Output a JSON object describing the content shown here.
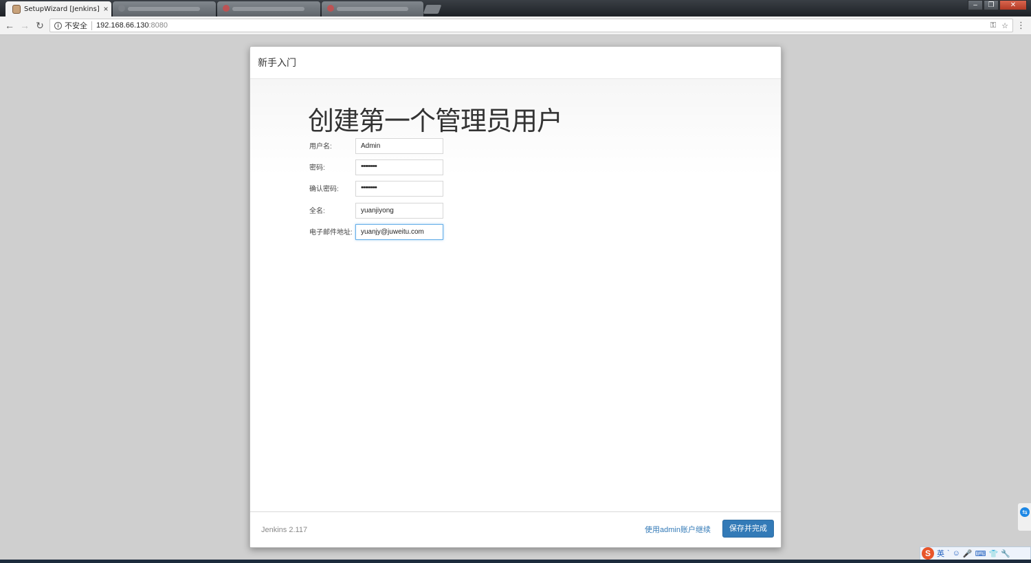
{
  "browser": {
    "active_tab_title": "SetupWizard [Jenkins]",
    "close_glyph": "×",
    "nav": {
      "back": "←",
      "forward": "→",
      "reload": "↻",
      "menu": "⋮"
    },
    "security_label": "不安全",
    "url_host": "192.168.66.130",
    "url_port": ":8080",
    "window_controls": {
      "minimize": "–",
      "restore": "❐",
      "close": "✕"
    },
    "omni_icons": {
      "key": "⚿",
      "star": "☆"
    }
  },
  "dialog": {
    "header_title": "新手入门",
    "heading": "创建第一个管理员用户",
    "fields": [
      {
        "label": "用户名:",
        "value": "Admin"
      },
      {
        "label": "密码:",
        "value": "••••••••"
      },
      {
        "label": "确认密码:",
        "value": "••••••••"
      },
      {
        "label": "全名:",
        "value": "yuanjiyong"
      },
      {
        "label": "电子邮件地址:",
        "value": "yuanjy@juweitu.com"
      }
    ],
    "version": "Jenkins 2.117",
    "continue_link": "使用admin账户继续",
    "save_button": "保存并完成"
  },
  "ime": {
    "logo": "S",
    "mode": "英",
    "icons": [
      "ˋ",
      "☺",
      "🎤",
      "⌨",
      "👕",
      "🔧"
    ]
  },
  "colors": {
    "primary_button": "#337ab7",
    "link": "#337ab7",
    "focus_border": "#66afe9",
    "page_background": "#cfcfcf"
  }
}
